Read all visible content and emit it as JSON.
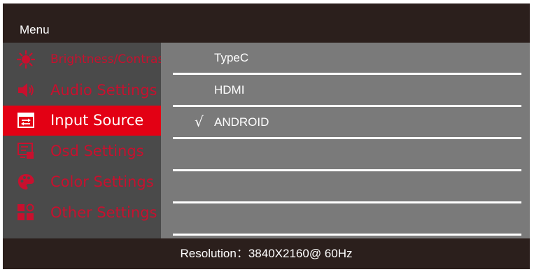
{
  "menu": {
    "title": "Menu"
  },
  "sidebar": {
    "items": [
      {
        "label": "Brightness/Contrast",
        "icon": "sun-icon",
        "active": false
      },
      {
        "label": "Audio Settings",
        "icon": "speaker-icon",
        "active": false
      },
      {
        "label": "Input Source",
        "icon": "input-source-icon",
        "active": true
      },
      {
        "label": "Osd Settings",
        "icon": "osd-icon",
        "active": false
      },
      {
        "label": "Color Settings",
        "icon": "palette-icon",
        "active": false
      },
      {
        "label": "Other Settings",
        "icon": "settings-grid-icon",
        "active": false
      }
    ]
  },
  "options": [
    {
      "label": "TypeC",
      "checked": false
    },
    {
      "label": "HDMI",
      "checked": false
    },
    {
      "label": "ANDROID",
      "checked": true,
      "check": "√"
    },
    {
      "label": "",
      "checked": false
    },
    {
      "label": "",
      "checked": false
    },
    {
      "label": "",
      "checked": false
    }
  ],
  "status": {
    "resolution": "Resolution：3840X2160@ 60Hz"
  },
  "colors": {
    "accent": "#e30014",
    "inactive_text": "#c8102e",
    "bar_bg": "#2b1f1c",
    "sidebar_bg": "#4a4a4a",
    "content_bg": "#7a7a7a"
  }
}
